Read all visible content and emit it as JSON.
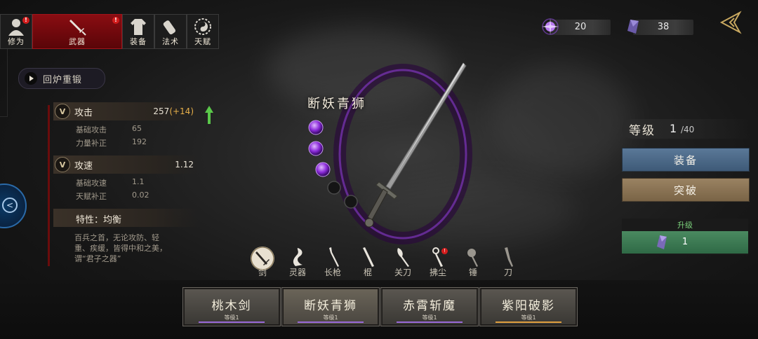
{
  "nav": {
    "tabs": [
      {
        "label": "修为",
        "icon": "avatar-icon",
        "badge": "!"
      },
      {
        "label": "武器",
        "icon": "sword-icon",
        "badge": "!",
        "active": true
      },
      {
        "label": "装备",
        "icon": "robe-icon"
      },
      {
        "label": "法术",
        "icon": "scroll-icon"
      },
      {
        "label": "天赋",
        "icon": "taiji-icon"
      }
    ]
  },
  "currency": [
    {
      "icon": "purple-orb-icon",
      "value": "20"
    },
    {
      "icon": "purple-crystal-icon",
      "value": "38"
    }
  ],
  "recast_label": "回炉重锻",
  "stats": {
    "attack": {
      "title": "攻击",
      "value": "257",
      "bonus": "(+14)",
      "rows": [
        {
          "label": "基础攻击",
          "value": "65"
        },
        {
          "label": "力量补正",
          "value": "192"
        }
      ]
    },
    "speed": {
      "title": "攻速",
      "value": "1.12",
      "rows": [
        {
          "label": "基础攻速",
          "value": "1.1"
        },
        {
          "label": "天赋补正",
          "value": "0.02"
        }
      ]
    },
    "trait_title": "特性：均衡",
    "trait_desc": "百兵之首，无论攻防、轻重、疾缓，皆得中和之美，谓“君子之器”"
  },
  "weapon": {
    "name": "断妖青狮",
    "gems_filled": 3,
    "gems_total": 5
  },
  "right": {
    "level_label": "等级",
    "level_current": "1",
    "level_max": "/40",
    "equip_label": "装备",
    "break_label": "突破",
    "upgrade_label": "升级",
    "upgrade_cost": "1"
  },
  "weapon_types": [
    {
      "label": "剑",
      "selected": true
    },
    {
      "label": "灵器"
    },
    {
      "label": "长枪"
    },
    {
      "label": "棍"
    },
    {
      "label": "关刀"
    },
    {
      "label": "拂尘",
      "badge": "!"
    },
    {
      "label": "锤"
    },
    {
      "label": "刀"
    }
  ],
  "cards": [
    {
      "name": "桃木剑",
      "level": "等级1",
      "bar_color": "#9a6ad8"
    },
    {
      "name": "断妖青狮",
      "level": "等级1",
      "bar_color": "#9a6ad8",
      "selected": true
    },
    {
      "name": "赤霄斩魔",
      "level": "等级1",
      "bar_color": "#9a6ad8"
    },
    {
      "name": "紫阳破影",
      "level": "等级1",
      "bar_color": "#e0a040"
    }
  ],
  "colors": {
    "accent_red": "#8a0d12",
    "gem_purple": "#9a3ad8",
    "equip_blue": "#4e6a88",
    "break_tan": "#8a7254",
    "upgrade_green": "#3f7a52"
  }
}
